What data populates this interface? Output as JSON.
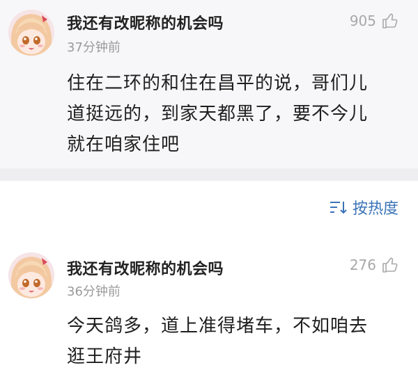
{
  "comments": [
    {
      "username": "我还有改昵称的机会吗",
      "time": "37分钟前",
      "likes": "905",
      "avatar_icon": "anime-avatar",
      "content_lines": [
        "住在二环的和住在昌平的说，哥们儿",
        "道挺远的，到家天都黑了，要不今儿",
        "就在咱家住吧"
      ]
    },
    {
      "username": "我还有改昵称的机会吗",
      "time": "36分钟前",
      "likes": "276",
      "avatar_icon": "anime-avatar",
      "content_lines": [
        "今天鸽多，道上准得堵车，不如咱去",
        "逛王府井"
      ]
    }
  ],
  "sort": {
    "label": "按热度",
    "icon": "sort-icon"
  },
  "colors": {
    "accent": "#3a73b8",
    "username": "#222222",
    "meta": "#9a9a9a",
    "highlight_bg": "#f7f7f9"
  }
}
